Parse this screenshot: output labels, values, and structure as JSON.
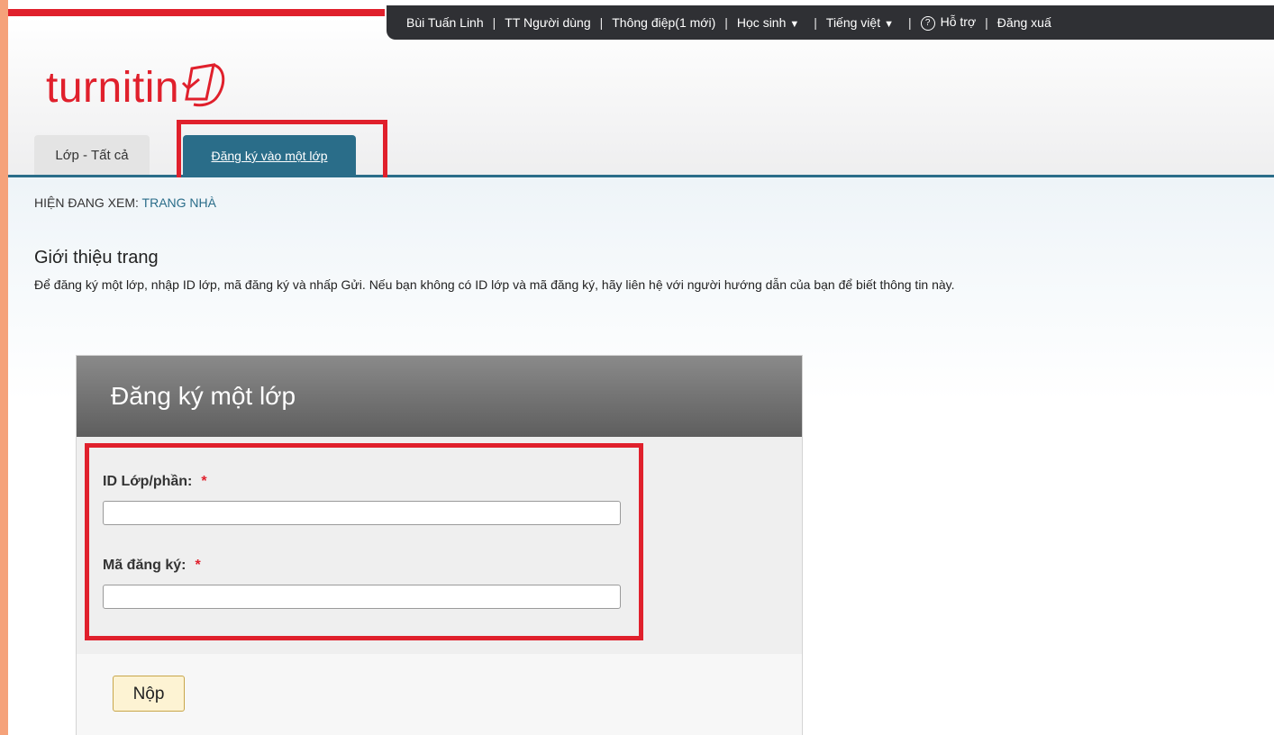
{
  "topbar": {
    "user_name": "Bùi Tuấn Linh",
    "user_info": "TT Người dùng",
    "messages": "Thông điệp(1 mới)",
    "role": "Học sinh",
    "language": "Tiếng việt",
    "help": "Hỗ trợ",
    "logout": "Đăng xuấ",
    "separator": "|"
  },
  "logo": {
    "text": "turnitin"
  },
  "tabs": {
    "all_classes": "Lớp - Tất cả",
    "enroll": "Đăng ký vào một lớp"
  },
  "breadcrumb": {
    "prefix": "HIỆN ĐANG XEM: ",
    "location": "TRANG NHÀ"
  },
  "intro": {
    "title": "Giới thiệu trang",
    "text": "Để đăng ký một lớp, nhập ID lớp, mã đăng ký và nhấp Gửi. Nếu bạn không có ID lớp và mã đăng ký, hãy liên hệ với người hướng dẫn của bạn để biết thông tin này."
  },
  "form": {
    "title": "Đăng ký một lớp",
    "class_id_label": "ID Lớp/phần:",
    "class_id_value": "",
    "enroll_key_label": "Mã đăng ký:",
    "enroll_key_value": "",
    "required_mark": "*",
    "submit_label": "Nộp"
  },
  "colors": {
    "brand_red": "#e0202c",
    "tab_blue": "#2a6d89",
    "topbar_dark": "#2f3034",
    "annotation_red": "#e0202c"
  }
}
